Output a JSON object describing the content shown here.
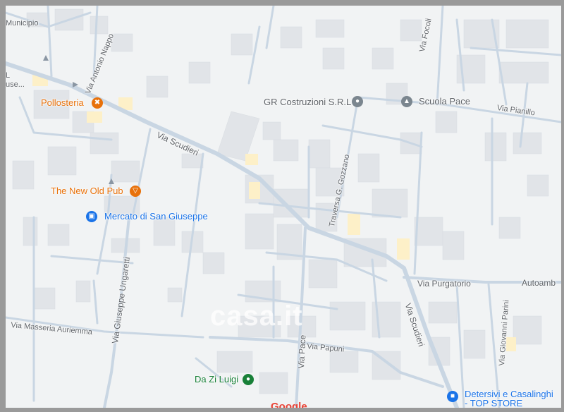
{
  "streets": {
    "municipio": "Municipio",
    "antonio_nappo": "Via Antonio Nappo",
    "scudieri_top": "Via Scudieri",
    "scudieri_bottom": "Via Scudieri",
    "gozzano": "Traversa G. Gozzano",
    "focoli": "Via Focoli",
    "pianillo": "Via Pianillo",
    "purgatorio": "Via Purgatorio",
    "ungaretti": "Via Giuseppe Ungaretti",
    "masseria": "Via Masseria Auriemma",
    "pace": "Via Pace",
    "papuni": "Via Papuni",
    "giovanni_parini": "Via Giovanni Parini",
    "autoamb": "Autoamb",
    "fragment_l": "L",
    "fragment_use": "use..."
  },
  "pois": {
    "pollosteria": "Pollosteria",
    "new_old_pub": "The New Old Pub",
    "mercato": "Mercato di San Giuseppe",
    "gr_costruzioni": "GR Costruzioni S.R.L",
    "scuola_pace": "Scuola Pace",
    "da_zi_luigi": "Da Zi Luigi",
    "detersivi_line1": "Detersivi e Casalinghi",
    "detersivi_line2": "- TOP STORE"
  },
  "watermark": "casa.it",
  "logo": "Google",
  "colors": {
    "road": "#c9d6e3",
    "building": "#e2e5e9",
    "building_yellow": "#fdf0c8",
    "food": "#e8710a",
    "shop": "#1a73e8",
    "service": "#5f6368",
    "restaurant_green": "#188038"
  }
}
